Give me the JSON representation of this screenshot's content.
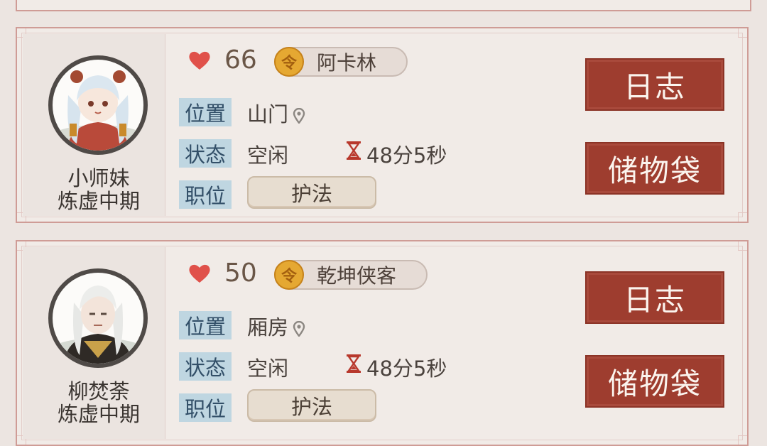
{
  "disciples": [
    {
      "name": "小师妹",
      "realm": "炼虚中期",
      "score": "66",
      "title": "阿卡林",
      "location_label": "位置",
      "location": "山门",
      "status_label": "状态",
      "status": "空闲",
      "timer": "48分5秒",
      "role_label": "职位",
      "role": "护法",
      "log_button": "日志",
      "bag_button": "储物袋"
    },
    {
      "name": "柳焚荼",
      "realm": "炼虚中期",
      "score": "50",
      "title": "乾坤侠客",
      "location_label": "位置",
      "location": "厢房",
      "status_label": "状态",
      "status": "空闲",
      "timer": "48分5秒",
      "role_label": "职位",
      "role": "护法",
      "log_button": "日志",
      "bag_button": "储物袋"
    }
  ],
  "icons": {
    "heart": "heart-icon",
    "title_badge": "title-badge-icon",
    "location": "location-pin-icon",
    "timer": "hourglass-icon"
  },
  "colors": {
    "accent_red": "#9e3d2f",
    "heart": "#e0514a",
    "label_bg": "#bfd6e1",
    "badge_gold": "#e5a832"
  }
}
